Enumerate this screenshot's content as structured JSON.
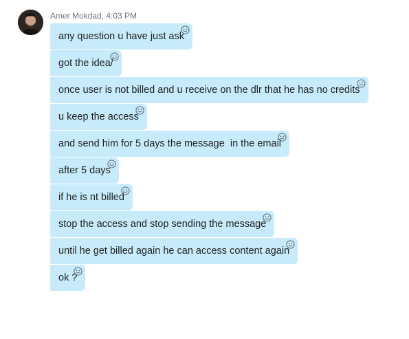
{
  "conversation": {
    "sender_line": "Amer Mokdad, 4:03 PM",
    "messages": [
      {
        "text": "any question u have just ask",
        "reaction_icon": "smiley-reaction-icon"
      },
      {
        "text": "got the idea/",
        "reaction_icon": "smiley-reaction-icon"
      },
      {
        "text": "once user is not billed and u receive on the dlr that he has no credits",
        "reaction_icon": "smiley-reaction-icon"
      },
      {
        "text": "u keep the access",
        "reaction_icon": "smiley-reaction-icon"
      },
      {
        "text": "and send him for 5 days the message  in the email",
        "reaction_icon": "smiley-reaction-icon"
      },
      {
        "text": "after 5 days",
        "reaction_icon": "smiley-reaction-icon"
      },
      {
        "text": "if he is nt billed",
        "reaction_icon": "smiley-reaction-icon"
      },
      {
        "text": "stop the access and stop sending the message",
        "reaction_icon": "smiley-reaction-icon"
      },
      {
        "text": "until he get billed again he can access content again",
        "reaction_icon": "smiley-reaction-icon"
      },
      {
        "text": "ok ?",
        "reaction_icon": "smiley-reaction-icon"
      }
    ]
  },
  "colors": {
    "bubble_background": "#c7ebfa",
    "meta_text": "#6b7480",
    "message_text": "#1f1f1f"
  }
}
